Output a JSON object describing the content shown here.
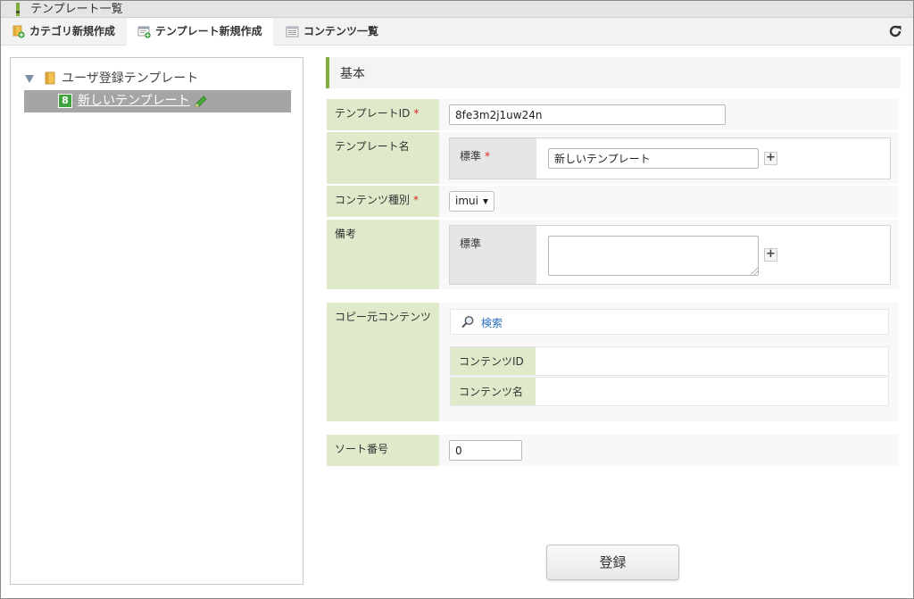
{
  "window": {
    "title": "テンプレート一覧"
  },
  "tabs": [
    {
      "label": "カテゴリ新規作成",
      "icon": "category-add-icon"
    },
    {
      "label": "テンプレート新規作成",
      "icon": "template-add-icon"
    },
    {
      "label": "コンテンツ一覧",
      "icon": "list-icon"
    }
  ],
  "tree": {
    "root_label": "ユーザ登録テンプレート",
    "item": {
      "badge": "8",
      "label": "新しいテンプレート"
    }
  },
  "section": {
    "title": "基本"
  },
  "form": {
    "template_id": {
      "label": "テンプレートID",
      "required": "*",
      "value": "8fe3m2j1uw24n"
    },
    "template_name": {
      "label": "テンプレート名",
      "locale_label": "標準",
      "required": "*",
      "value": "新しいテンプレート",
      "add": "+"
    },
    "content_type": {
      "label": "コンテンツ種別",
      "required": "*",
      "value": "imui"
    },
    "remarks": {
      "label": "備考",
      "locale_label": "標準",
      "value": "",
      "add": "+"
    },
    "copy_source": {
      "label": "コピー元コンテンツ",
      "search_label": "検索",
      "content_id_label": "コンテンツID",
      "content_name_label": "コンテンツ名"
    },
    "sort_no": {
      "label": "ソート番号",
      "value": "0"
    }
  },
  "submit_label": "登録",
  "colors": {
    "accent": "#7fae3e",
    "label_bg": "#dfeacb",
    "link": "#2a6ebb",
    "required": "#dd2222"
  }
}
